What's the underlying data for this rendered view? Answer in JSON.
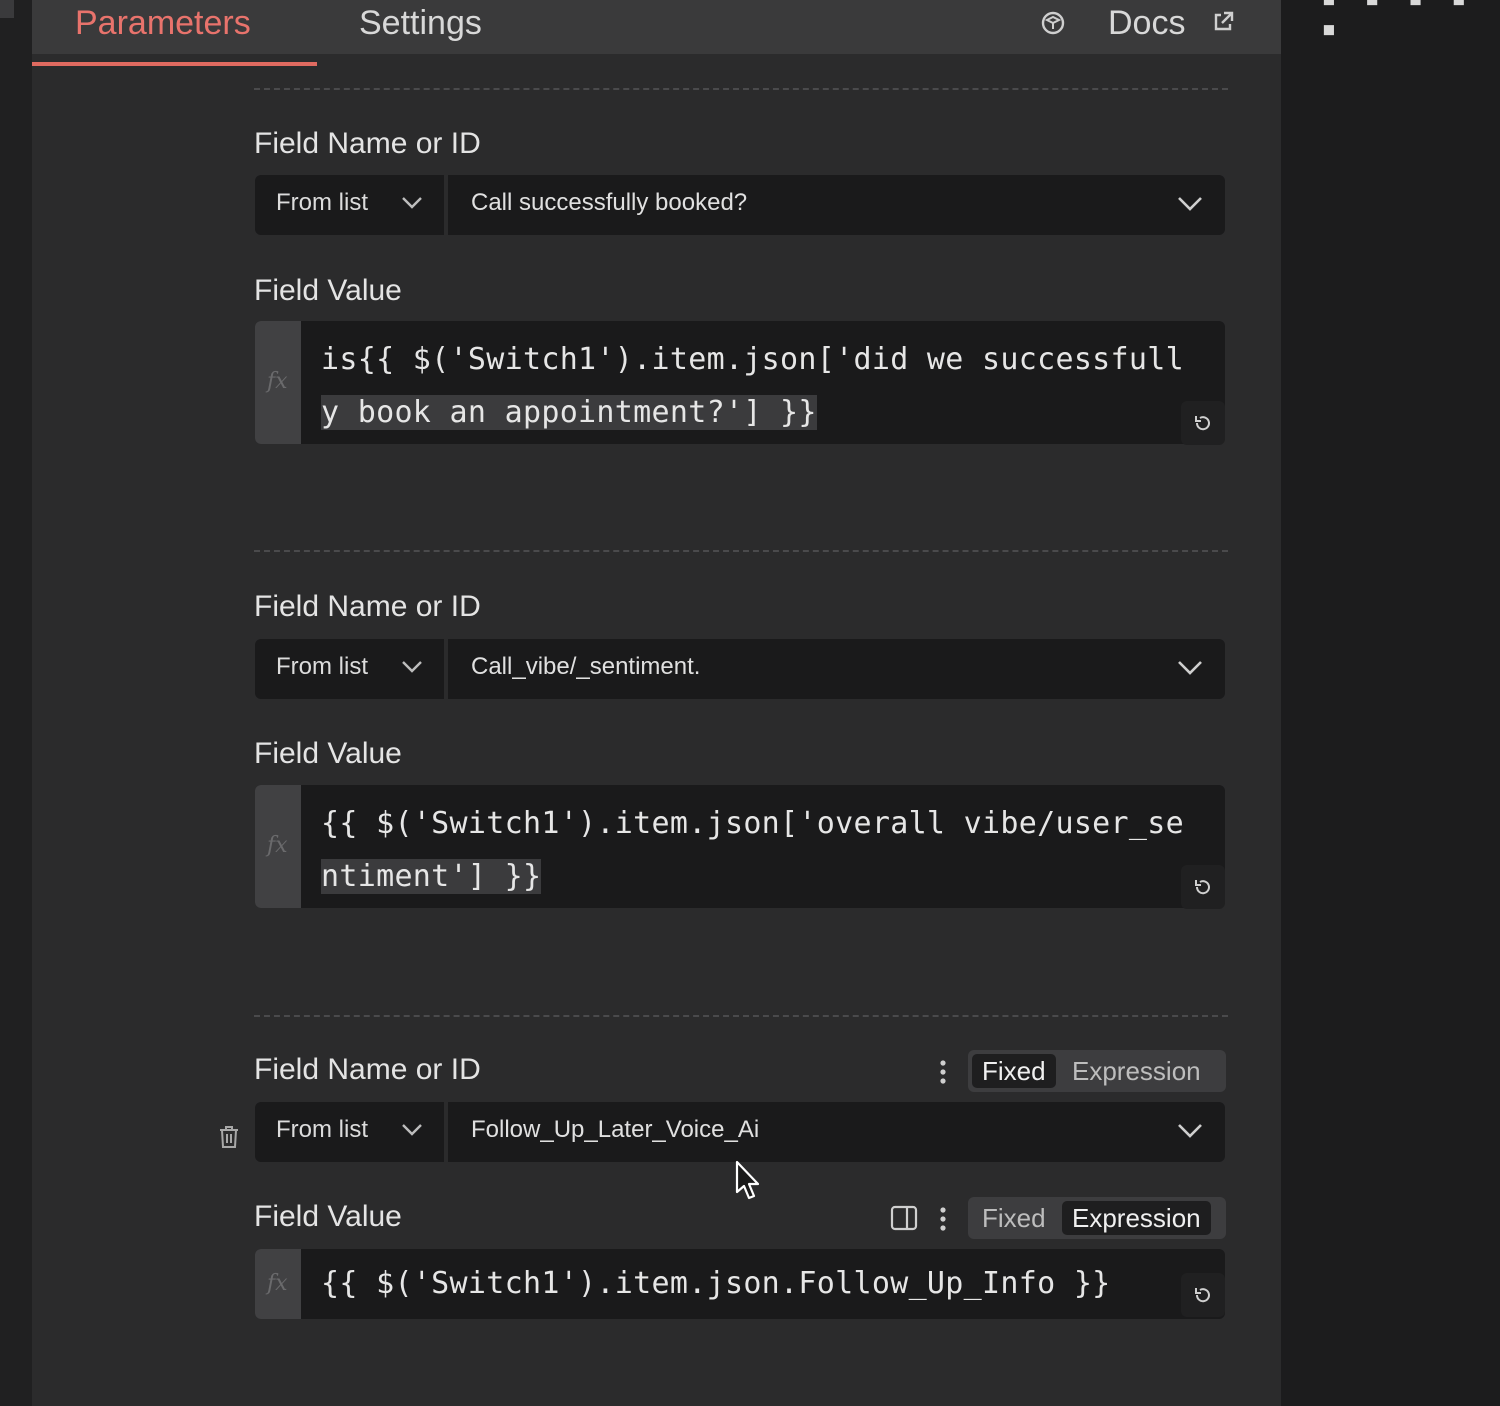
{
  "header": {
    "tabs": [
      {
        "label": "Parameters",
        "active": true
      },
      {
        "label": "Settings",
        "active": false
      }
    ],
    "docs_label": "Docs",
    "accent_color": "#e8736c",
    "icons": [
      "package-icon",
      "external-link-icon"
    ]
  },
  "fields": [
    {
      "name_label": "Field Name or ID",
      "mode": "From list",
      "selected": "Call successfully booked?",
      "value_label": "Field Value",
      "expression_lines": [
        "is{{ $('Switch1').item.json['did we successfull",
        "y book an appointment?'] }}"
      ]
    },
    {
      "name_label": "Field Name or ID",
      "mode": "From list",
      "selected": "Call_vibe/_sentiment.",
      "value_label": "Field Value",
      "expression_lines": [
        "{{ $('Switch1').item.json['overall vibe/user_se",
        "ntiment'] }}"
      ]
    },
    {
      "name_label": "Field Name or ID",
      "mode": "From list",
      "selected": "Follow_Up_Later_Voice_Ai",
      "value_label": "Field Value",
      "expression_lines": [
        "{{ $('Switch1').item.json.Follow_Up_Info }}"
      ],
      "name_toggle": {
        "fixed": "Fixed",
        "expression": "Expression",
        "active": "fixed"
      },
      "value_toggle": {
        "fixed": "Fixed",
        "expression": "Expression",
        "active": "expression"
      }
    }
  ],
  "fx_symbol": "fx"
}
